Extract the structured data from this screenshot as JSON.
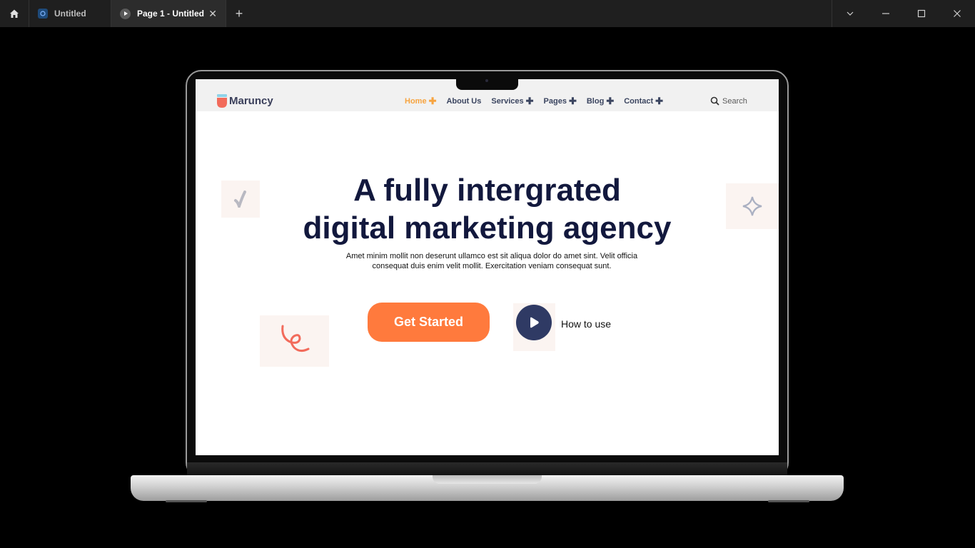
{
  "titlebar": {
    "tabs": [
      {
        "label": "Untitled"
      },
      {
        "label": "Page 1 - Untitled"
      }
    ]
  },
  "site": {
    "brand": "Maruncy",
    "menu": [
      {
        "label": "Home"
      },
      {
        "label": "About Us"
      },
      {
        "label": "Services"
      },
      {
        "label": "Pages"
      },
      {
        "label": "Blog"
      },
      {
        "label": "Contact"
      }
    ],
    "search_label": "Search"
  },
  "hero": {
    "title_line1": "A fully intergrated",
    "title_line2": "digital marketing agency",
    "subtitle": "Amet minim mollit non deserunt ullamco est sit aliqua dolor do amet sint. Velit officia consequat duis enim velit mollit. Exercitation veniam consequat sunt.",
    "cta": "Get Started",
    "howto": "How to use"
  },
  "colors": {
    "accent": "#ff7a3d",
    "nav_active": "#f7a440",
    "title": "#12183d",
    "play": "#2f3a64"
  }
}
